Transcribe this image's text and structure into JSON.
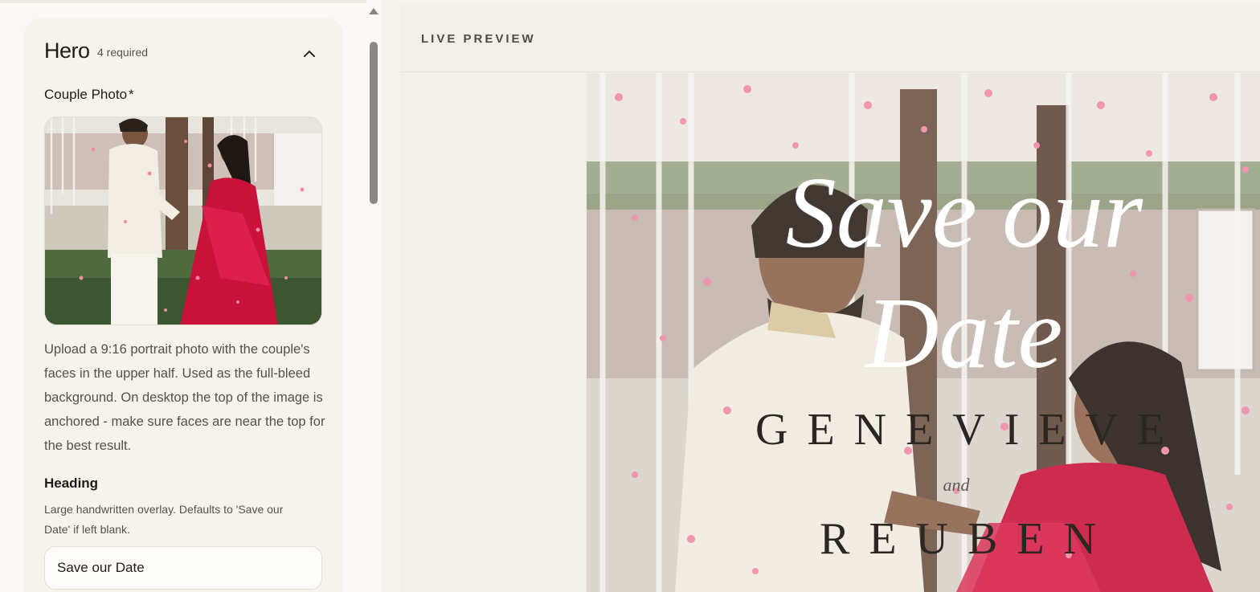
{
  "editor": {
    "section": {
      "title": "Hero",
      "required_count": "4 required"
    },
    "photo_field": {
      "label": "Couple Photo",
      "required_marker": "*",
      "help": "Upload a 9:16 portrait photo with the couple's faces in the upper half. Used as the full-bleed background. On desktop the top of the image is anchored - make sure faces are near the top for the best result."
    },
    "heading_field": {
      "label": "Heading",
      "help": "Large handwritten overlay. Defaults to 'Save our Date' if left blank.",
      "value": "Save our Date"
    }
  },
  "preview": {
    "label": "LIVE PREVIEW",
    "heading_line1": "Save our",
    "heading_line2": "Date",
    "name_1": "GENEVIEVE",
    "connector": "and",
    "name_2": "REUBEN"
  },
  "colors": {
    "accent_red": "#c8123a",
    "petal_pink": "#f08aa6",
    "panel_bg": "#f6f2ec"
  }
}
